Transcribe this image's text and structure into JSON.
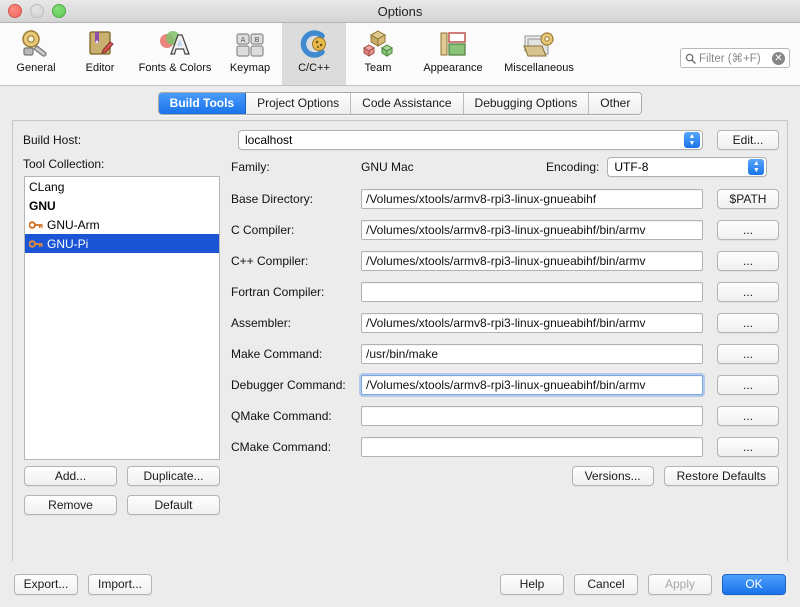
{
  "window": {
    "title": "Options",
    "traffic_lights": [
      "close",
      "minimize",
      "zoom"
    ]
  },
  "toolbar": {
    "items": [
      {
        "label": "General",
        "icon": "gear-wrench-icon"
      },
      {
        "label": "Editor",
        "icon": "book-pencil-icon"
      },
      {
        "label": "Fonts & Colors",
        "icon": "fonts-colors-icon"
      },
      {
        "label": "Keymap",
        "icon": "keyboard-icon"
      },
      {
        "label": "C/C++",
        "icon": "c-cplusplus-icon",
        "selected": true
      },
      {
        "label": "Team",
        "icon": "team-cubes-icon"
      },
      {
        "label": "Appearance",
        "icon": "appearance-icon"
      },
      {
        "label": "Miscellaneous",
        "icon": "miscellaneous-icon"
      }
    ],
    "filter_placeholder": "Filter (⌘+F)",
    "clear_icon": "✕"
  },
  "tabs": [
    {
      "label": "Build Tools",
      "active": true
    },
    {
      "label": "Project Options",
      "active": false
    },
    {
      "label": "Code Assistance",
      "active": false
    },
    {
      "label": "Debugging Options",
      "active": false
    },
    {
      "label": "Other",
      "active": false
    }
  ],
  "build_host": {
    "label": "Build Host:",
    "value": "localhost",
    "edit_button": "Edit..."
  },
  "tool_collection": {
    "label": "Tool Collection:",
    "items": [
      {
        "name": "CLang",
        "bold": false,
        "selected": false,
        "has_key": false
      },
      {
        "name": "GNU",
        "bold": true,
        "selected": false,
        "has_key": false
      },
      {
        "name": "GNU-Arm",
        "bold": false,
        "selected": false,
        "has_key": true
      },
      {
        "name": "GNU-Pi",
        "bold": false,
        "selected": true,
        "has_key": true
      }
    ],
    "buttons": [
      "Add...",
      "Duplicate...",
      "Remove",
      "Default"
    ]
  },
  "details": {
    "family_label": "Family:",
    "family_value": "GNU Mac",
    "encoding_label": "Encoding:",
    "encoding_value": "UTF-8",
    "fields": [
      {
        "label": "Base Directory:",
        "value": "/Volumes/xtools/armv8-rpi3-linux-gnueabihf",
        "button": "$PATH",
        "focused": false
      },
      {
        "label": "C Compiler:",
        "value": "/Volumes/xtools/armv8-rpi3-linux-gnueabihf/bin/armv",
        "button": "...",
        "focused": false
      },
      {
        "label": "C++ Compiler:",
        "value": "/Volumes/xtools/armv8-rpi3-linux-gnueabihf/bin/armv",
        "button": "...",
        "focused": false
      },
      {
        "label": "Fortran Compiler:",
        "value": "",
        "button": "...",
        "focused": false
      },
      {
        "label": "Assembler:",
        "value": "/Volumes/xtools/armv8-rpi3-linux-gnueabihf/bin/armv",
        "button": "...",
        "focused": false
      },
      {
        "label": "Make Command:",
        "value": "/usr/bin/make",
        "button": "...",
        "focused": false
      },
      {
        "label": "Debugger Command:",
        "value": "/Volumes/xtools/armv8-rpi3-linux-gnueabihf/bin/armv",
        "button": "...",
        "focused": true
      },
      {
        "label": "QMake Command:",
        "value": "",
        "button": "...",
        "focused": false
      },
      {
        "label": "CMake Command:",
        "value": "",
        "button": "...",
        "focused": false
      }
    ],
    "versions_button": "Versions...",
    "restore_defaults_button": "Restore Defaults"
  },
  "footer": {
    "export_label": "Export...",
    "import_label": "Import...",
    "help_label": "Help",
    "cancel_label": "Cancel",
    "apply_label": "Apply",
    "ok_label": "OK"
  },
  "colors": {
    "accent_blue": "#1a73e8",
    "selection_blue": "#1b55d6",
    "window_bg": "#ececec",
    "key_icon_orange": "#d4762a"
  }
}
